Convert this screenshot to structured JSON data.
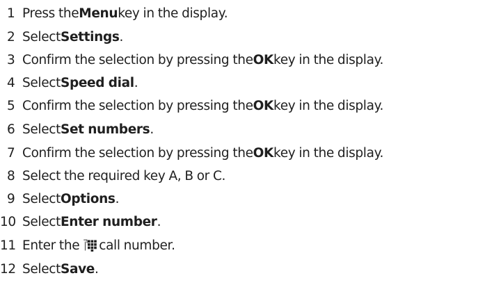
{
  "steps": [
    {
      "n": "1",
      "pre": "Press the ",
      "bold": "Menu",
      "post": " key in the display."
    },
    {
      "n": "2",
      "pre": "Select ",
      "bold": "Settings",
      "post": "."
    },
    {
      "n": "3",
      "pre": "Confirm the selection by pressing the ",
      "bold": "OK",
      "post": " key in the display."
    },
    {
      "n": "4",
      "pre": "Select ",
      "bold": "Speed dial",
      "post": "."
    },
    {
      "n": "5",
      "pre": "Confirm the selection by pressing the ",
      "bold": "OK",
      "post": " key in the display."
    },
    {
      "n": "6",
      "pre": "Select ",
      "bold": "Set numbers",
      "post": "."
    },
    {
      "n": "7",
      "pre": "Confirm the selection by pressing the ",
      "bold": "OK",
      "post": " key in the display."
    },
    {
      "n": "8",
      "pre": "Select the required key A, B or C.",
      "bold": "",
      "post": ""
    },
    {
      "n": "9",
      "pre": "Select ",
      "bold": "Options",
      "post": "."
    },
    {
      "n": "10",
      "pre": "Select ",
      "bold": "Enter number",
      "post": "."
    },
    {
      "n": "11",
      "pre": "Enter the",
      "bold": "",
      "post": "call number.",
      "icon": "keypad-icon"
    },
    {
      "n": "12",
      "pre": "Select ",
      "bold": "Save",
      "post": "."
    }
  ]
}
